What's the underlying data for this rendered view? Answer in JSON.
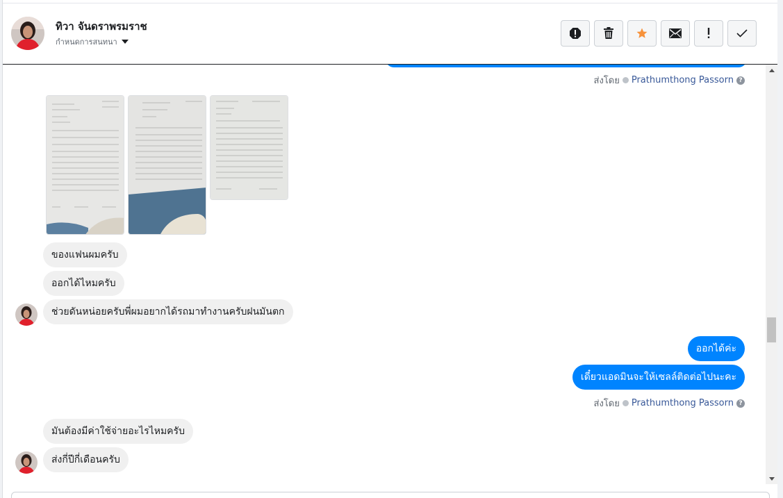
{
  "header": {
    "contact_name": "ทิวา จันดราพรมราช",
    "assign_label": "กำหนดการสนทนา",
    "actions": [
      {
        "name": "spam",
        "icon": "alert-circle-icon"
      },
      {
        "name": "delete",
        "icon": "trash-icon"
      },
      {
        "name": "star",
        "icon": "star-icon"
      },
      {
        "name": "mark-unread",
        "icon": "envelope-icon"
      },
      {
        "name": "follow-up",
        "icon": "exclamation-icon"
      },
      {
        "name": "done",
        "icon": "check-icon"
      }
    ]
  },
  "thread": {
    "sent_by_prefix": "ส่งโดย",
    "agent_name": "Prathumthong Passorn",
    "photos": [
      "document-photo-1",
      "document-photo-2",
      "document-photo-3"
    ],
    "messages": [
      {
        "dir": "in",
        "text": "ของแฟนผมครับ"
      },
      {
        "dir": "in",
        "text": "ออกได้ไหมครับ"
      },
      {
        "dir": "in",
        "text": "ช่วยดันหน่อยครับพี่ผมอยากได้รถมาทำงานครับฝนมันตก"
      },
      {
        "dir": "out",
        "text": "ออกได้ค่ะ"
      },
      {
        "dir": "out",
        "text": "เดี๋ยวแอดมินจะให้เซลล์ติดต่อไปนะคะ"
      },
      {
        "dir": "in",
        "text": "มันต้องมีค่าใช้จ่ายอะไรไหมครับ"
      },
      {
        "dir": "in",
        "text": "ส่งกี่ปีกี่เดือนครับ"
      }
    ]
  },
  "colors": {
    "outgoing_bubble": "#0084ff",
    "incoming_bubble": "#f0f0f0",
    "star": "#f7923b",
    "agent_link": "#385898"
  }
}
